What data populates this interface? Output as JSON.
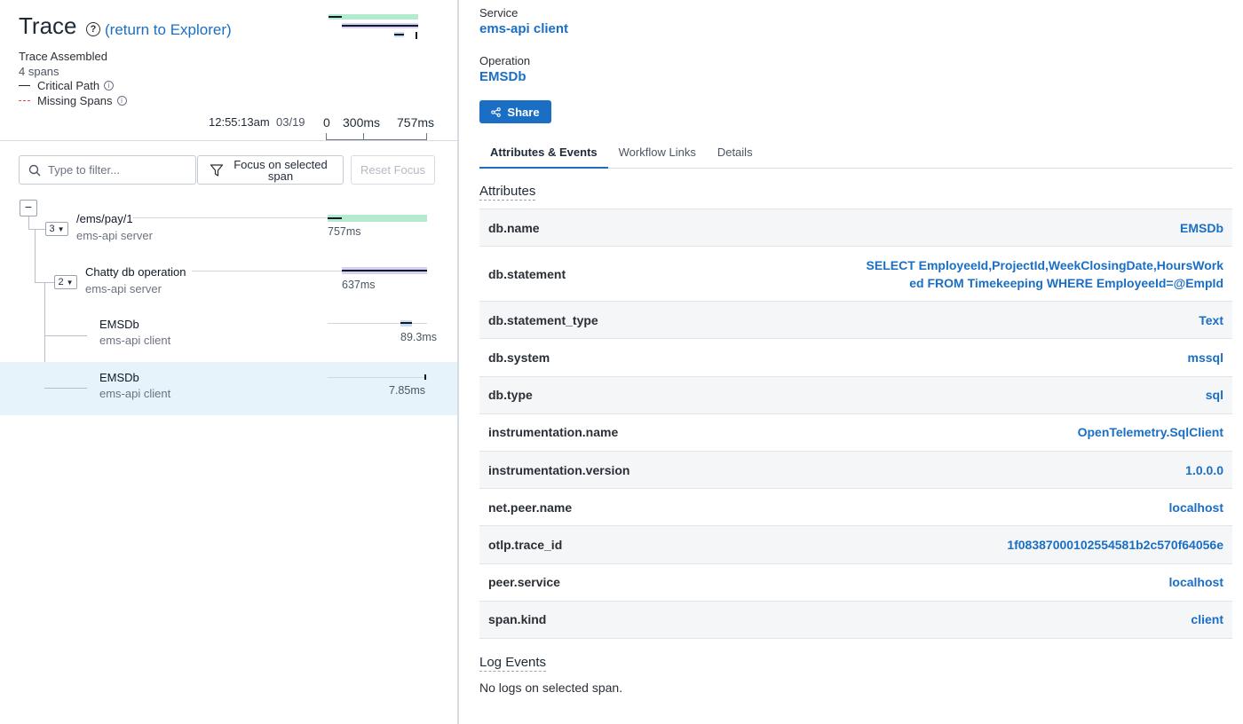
{
  "header": {
    "title": "Trace",
    "return_link": "(return to Explorer)",
    "assembled": "Trace Assembled",
    "span_count": "4 spans",
    "legend": {
      "critical_path": "Critical Path",
      "missing_spans": "Missing Spans"
    },
    "time": "12:55:13am",
    "date": "03/19",
    "axis_ticks": [
      "0",
      "300ms",
      "757ms"
    ]
  },
  "toolbar": {
    "filter_placeholder": "Type to filter...",
    "focus_label": "Focus on selected span",
    "reset_label": "Reset Focus"
  },
  "spans": [
    {
      "name": "/ems/pay/1",
      "service": "ems-api server",
      "duration": "757ms",
      "child_count": "3"
    },
    {
      "name": "Chatty db operation",
      "service": "ems-api server",
      "duration": "637ms",
      "child_count": "2"
    },
    {
      "name": "EMSDb",
      "service": "ems-api client",
      "duration": "89.3ms"
    },
    {
      "name": "EMSDb",
      "service": "ems-api client",
      "duration": "7.85ms"
    }
  ],
  "details": {
    "service_label": "Service",
    "service_value": "ems-api client",
    "operation_label": "Operation",
    "operation_value": "EMSDb",
    "share_label": "Share",
    "tabs": [
      "Attributes & Events",
      "Workflow Links",
      "Details"
    ],
    "attributes_heading": "Attributes",
    "attributes": [
      {
        "key": "db.name",
        "value": "EMSDb"
      },
      {
        "key": "db.statement",
        "value": "SELECT EmployeeId,ProjectId,WeekClosingDate,HoursWorked FROM Timekeeping WHERE EmployeeId=@EmpId"
      },
      {
        "key": "db.statement_type",
        "value": "Text"
      },
      {
        "key": "db.system",
        "value": "mssql"
      },
      {
        "key": "db.type",
        "value": "sql"
      },
      {
        "key": "instrumentation.name",
        "value": "OpenTelemetry.SqlClient"
      },
      {
        "key": "instrumentation.version",
        "value": "1.0.0.0"
      },
      {
        "key": "net.peer.name",
        "value": "localhost"
      },
      {
        "key": "otlp.trace_id",
        "value": "1f08387000102554581b2c570f64056e"
      },
      {
        "key": "peer.service",
        "value": "localhost"
      },
      {
        "key": "span.kind",
        "value": "client"
      }
    ],
    "log_events_heading": "Log Events",
    "no_logs": "No logs on selected span."
  },
  "colors": {
    "accent": "#1a6fc4",
    "root_span": "#b4ead0",
    "child_span": "#d6d0f2",
    "leaf_span": "#c9def1",
    "selected_row": "#e6f3fa",
    "missing_spans": "#e5484d"
  }
}
